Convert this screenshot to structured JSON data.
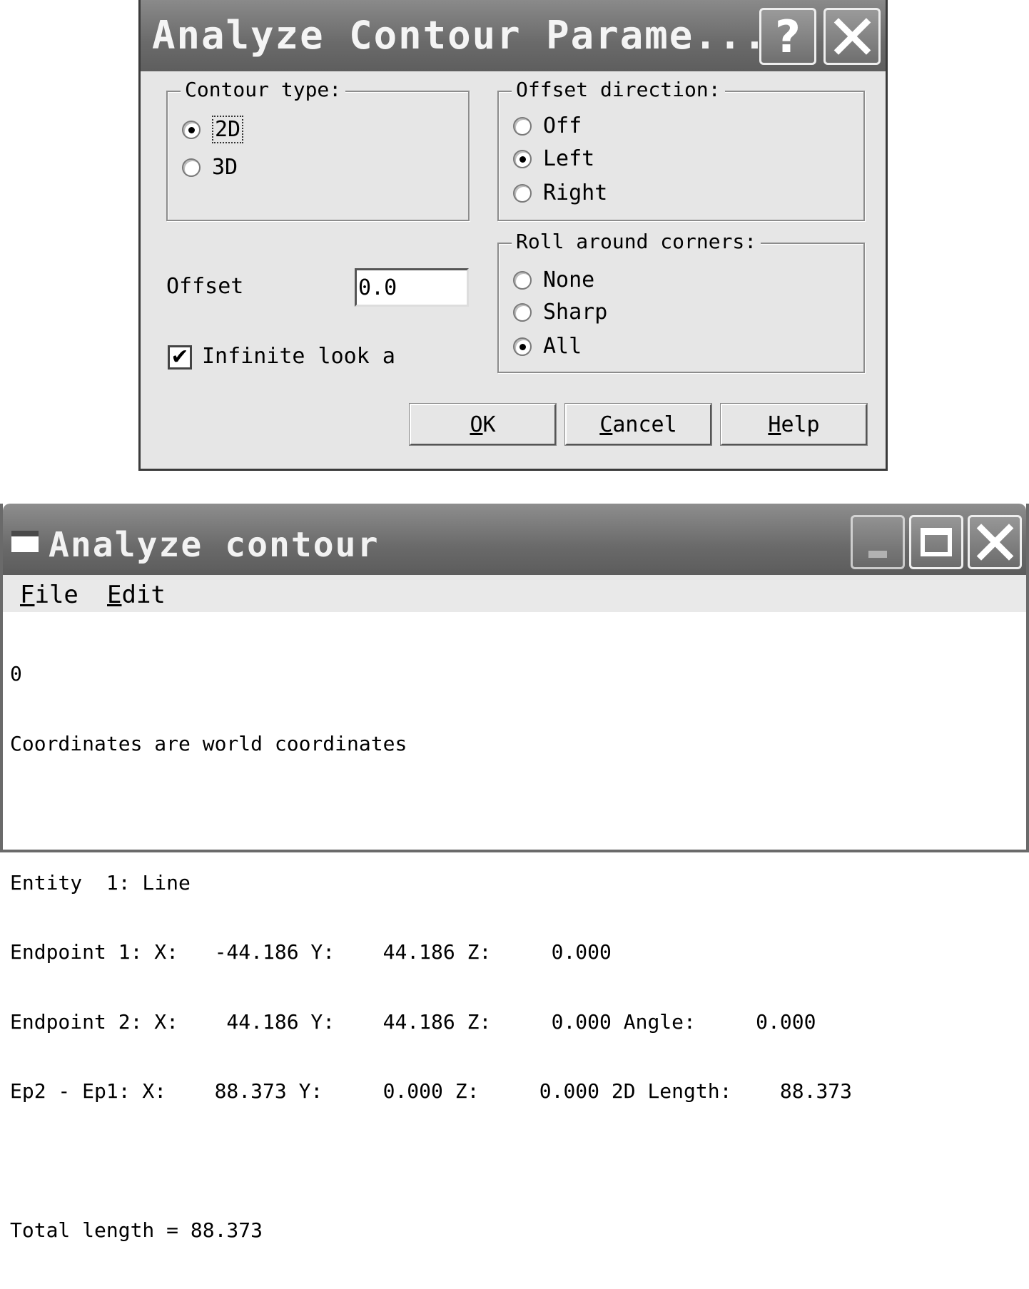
{
  "dialog": {
    "title": "Analyze Contour Parame...",
    "help_icon": "question-mark-icon",
    "close_icon": "close-icon",
    "contour_type": {
      "label": "Contour type:",
      "options": [
        {
          "label": "2D",
          "selected": true
        },
        {
          "label": "3D",
          "selected": false
        }
      ]
    },
    "offset_direction": {
      "label": "Offset direction:",
      "options": [
        {
          "label": "Off",
          "selected": false
        },
        {
          "label": "Left",
          "selected": true
        },
        {
          "label": "Right",
          "selected": false
        }
      ]
    },
    "roll_around_corners": {
      "label": "Roll around corners:",
      "options": [
        {
          "label": "None",
          "selected": false
        },
        {
          "label": "Sharp",
          "selected": false
        },
        {
          "label": "All",
          "selected": true
        }
      ]
    },
    "offset": {
      "label": "Offset",
      "value": "0.0"
    },
    "infinite_look": {
      "label": "Infinite look a",
      "checked": true
    },
    "buttons": {
      "ok": {
        "first": "O",
        "rest": "K"
      },
      "cancel": {
        "first": "C",
        "rest": "ancel"
      },
      "help": {
        "first": "H",
        "rest": "elp"
      }
    }
  },
  "main_window": {
    "title": "Analyze contour",
    "menu": {
      "file": {
        "first": "F",
        "rest": "ile"
      },
      "edit": {
        "first": "E",
        "rest": "dit"
      }
    },
    "output_lines": [
      "0",
      "Coordinates are world coordinates",
      "",
      "Entity  1: Line",
      "Endpoint 1: X:   -44.186 Y:    44.186 Z:     0.000",
      "Endpoint 2: X:    44.186 Y:    44.186 Z:     0.000 Angle:     0.000",
      "Ep2 - Ep1: X:    88.373 Y:     0.000 Z:     0.000 2D Length:    88.373",
      "",
      "Total length = 88.373"
    ]
  }
}
